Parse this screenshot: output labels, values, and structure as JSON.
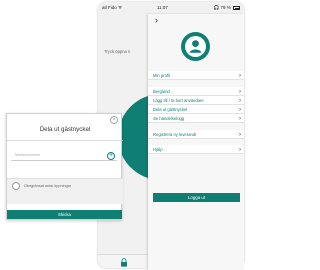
{
  "status_bar": {
    "carrier": "atl Fido ᯤ",
    "time": "11:07",
    "battery": "🎧 79 %"
  },
  "main": {
    "instruction": "Tryck öppna n",
    "hint": "Du har"
  },
  "menu": {
    "close_icon": "chevron-right-icon",
    "items": [
      {
        "label": "Min profil",
        "chevron": "›"
      },
      {
        "label": "Berglund",
        "chevron": "›"
      },
      {
        "label": "Lägg till / ta bort användare",
        "chevron": "›"
      },
      {
        "label": "Dela ut gästnyckel",
        "chevron": "›"
      },
      {
        "label": "Se händelselogg",
        "chevron": "›"
      },
      {
        "label": "Registrera ny leverandr",
        "chevron": "›"
      },
      {
        "label": "Hjälp",
        "chevron": "›"
      }
    ],
    "logout_label": "Logga ut"
  },
  "modal": {
    "title": "Dela ut gästnyckel",
    "field_placeholder": "Telefonnummer",
    "checkbox_label": "Obegränsat antal öppningar",
    "send_label": "Skicka"
  },
  "colors": {
    "accent": "#0f7f73"
  }
}
